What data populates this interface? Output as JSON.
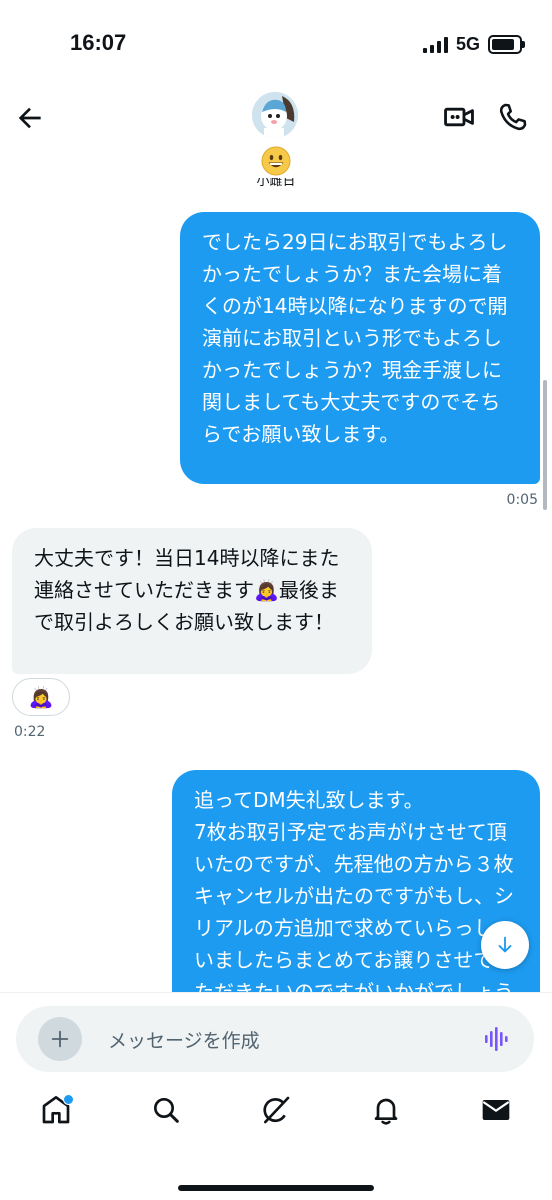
{
  "status": {
    "time": "16:07",
    "network": "5G"
  },
  "header": {
    "back_icon": "arrow-left-icon",
    "avatar_icon": "avatar",
    "emoji": "grinning-face-emoji",
    "name_peek": "小雌日",
    "video_icon": "video-call-icon",
    "phone_icon": "phone-icon"
  },
  "messages": [
    {
      "direction": "outgoing",
      "text": "でしたら29日にお取引でもよろしかったでしょうか？また会場に着くのが14時以降になりますので開演前にお取引という形でもよろしかったでしょうか？現金手渡しに関しましても大丈夫ですのでそちらでお願い致します。",
      "time": "0:05"
    },
    {
      "direction": "incoming",
      "text": "大丈夫です！当日14時以降にまた連絡させていただきます🙇‍♀️最後まで取引よろしくお願い致します！",
      "reaction": "🙇‍♀️",
      "time": "0:22"
    },
    {
      "direction": "outgoing",
      "text": "追ってDM失礼致します。\n7枚お取引予定でお声がけさせて頂いたのですが、先程他の方から３枚キャンセルが出たのですがもし、シリアルの方追加で求めていらっしゃいましたらまとめてお譲りさせていただきたいのですがいかがでしょうか？そ"
    }
  ],
  "composer": {
    "placeholder": "メッセージを作成"
  },
  "tabbar": [
    "home-icon",
    "search-icon",
    "grok-icon",
    "notifications-icon",
    "messages-icon"
  ],
  "colors": {
    "accent": "#1d9bf0",
    "incoming_bubble": "#eff3f4",
    "text": "#0f1419",
    "secondary": "#536471"
  }
}
